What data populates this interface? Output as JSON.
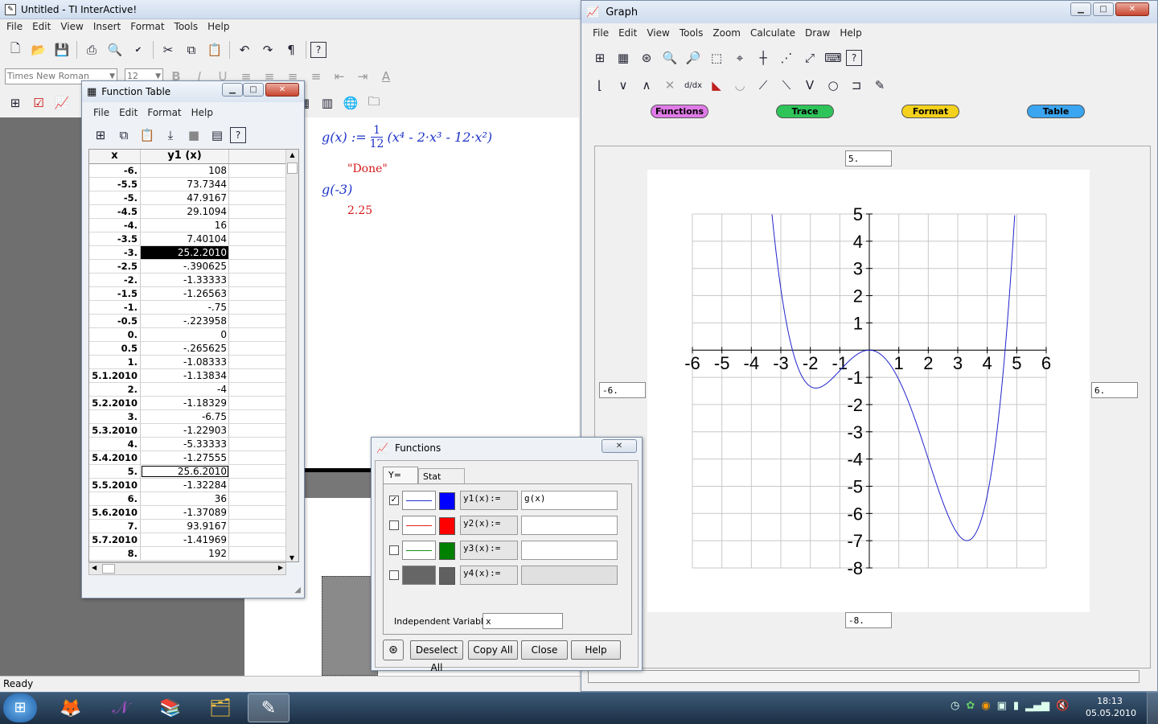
{
  "main": {
    "title": "Untitled - TI InterActive!",
    "menu": [
      "File",
      "Edit",
      "View",
      "Insert",
      "Format",
      "Tools",
      "Help"
    ],
    "font_name": "Times New Roman",
    "font_size": "12",
    "status": "Ready",
    "math": {
      "def_lhs": "g(x) :=",
      "frac_num": "1",
      "frac_den": "12",
      "def_rhs": "(x⁴ - 2·x³ - 12·x²)",
      "done": "\"Done\"",
      "call": "g(-3)",
      "result": "2.25"
    }
  },
  "table": {
    "title": "Function Table",
    "menu": [
      "File",
      "Edit",
      "Format",
      "Help"
    ],
    "col_x": "x",
    "col_y": "y1 (x)",
    "rows": [
      [
        "-6.",
        "108"
      ],
      [
        "-5.5",
        "73.7344"
      ],
      [
        "-5.",
        "47.9167"
      ],
      [
        "-4.5",
        "29.1094"
      ],
      [
        "-4.",
        "16"
      ],
      [
        "-3.5",
        "7.40104"
      ],
      [
        "-3.",
        "25.2.2010"
      ],
      [
        "-2.5",
        "-.390625"
      ],
      [
        "-2.",
        "-1.33333"
      ],
      [
        "-1.5",
        "-1.26563"
      ],
      [
        "-1.",
        "-.75"
      ],
      [
        "-0.5",
        "-.223958"
      ],
      [
        "0.",
        "0"
      ],
      [
        "0.5",
        "-.265625"
      ],
      [
        "1.",
        "-1.08333"
      ],
      [
        "5.1.2010",
        "-1.13834"
      ],
      [
        "2.",
        "-4"
      ],
      [
        "5.2.2010",
        "-1.18329"
      ],
      [
        "3.",
        "-6.75"
      ],
      [
        "5.3.2010",
        "-1.22903"
      ],
      [
        "4.",
        "-5.33333"
      ],
      [
        "5.4.2010",
        "-1.27555"
      ],
      [
        "5.",
        "25.6.2010"
      ],
      [
        "5.5.2010",
        "-1.32284"
      ],
      [
        "6.",
        "36"
      ],
      [
        "5.6.2010",
        "-1.37089"
      ],
      [
        "7.",
        "93.9167"
      ],
      [
        "5.7.2010",
        "-1.41969"
      ],
      [
        "8.",
        "192"
      ]
    ]
  },
  "graph": {
    "title": "Graph",
    "menu": [
      "File",
      "Edit",
      "View",
      "Tools",
      "Zoom",
      "Calculate",
      "Draw",
      "Help"
    ],
    "tabs": [
      {
        "label": "Functions",
        "color": "#e07ae8"
      },
      {
        "label": "Trace",
        "color": "#2ec45a"
      },
      {
        "label": "Format",
        "color": "#f4d11c"
      },
      {
        "label": "Table",
        "color": "#3aa5f0"
      }
    ],
    "ymax_field": "5.",
    "ymin_field": "-8.",
    "xmin_field": "-6.",
    "xmax_field": "6.",
    "x_ticks": [
      "-6",
      "-5",
      "-4",
      "-3",
      "-2",
      "-1",
      "1",
      "2",
      "3",
      "4",
      "5",
      "6"
    ],
    "y_ticks": [
      "5",
      "4",
      "3",
      "2",
      "1",
      "-1",
      "-2",
      "-3",
      "-4",
      "-5",
      "-6",
      "-7",
      "-8"
    ]
  },
  "chart_data": {
    "type": "line",
    "series": [
      {
        "name": "y1(x)",
        "function": "(x^4 - 2x^3 - 12x^2)/12",
        "color": "#2222cc"
      }
    ],
    "xlim": [
      -6,
      6
    ],
    "ylim": [
      -8,
      5
    ],
    "grid": true
  },
  "functions": {
    "title": "Functions",
    "tab_y": "Y=",
    "tab_stat": "Stat Plots",
    "rows": [
      {
        "checked": true,
        "line_color": "#1d2fd0",
        "swatch": "#0000ff",
        "name": "y1(x):=",
        "expr": "g(x)"
      },
      {
        "checked": false,
        "line_color": "#e02020",
        "swatch": "#ff0000",
        "name": "y2(x):=",
        "expr": ""
      },
      {
        "checked": false,
        "line_color": "#169216",
        "swatch": "#008000",
        "name": "y3(x):=",
        "expr": ""
      },
      {
        "checked": false,
        "line_color": "#606060",
        "swatch": "#606060",
        "name": "y4(x):=",
        "expr": ""
      }
    ],
    "indep_label": "Independent Variable:",
    "indep_value": "x",
    "btn_deselect": "Deselect All",
    "btn_copy": "Copy All",
    "btn_close": "Close",
    "btn_help": "Help"
  },
  "taskbar": {
    "time": "18:13",
    "date": "05.05.2010"
  }
}
